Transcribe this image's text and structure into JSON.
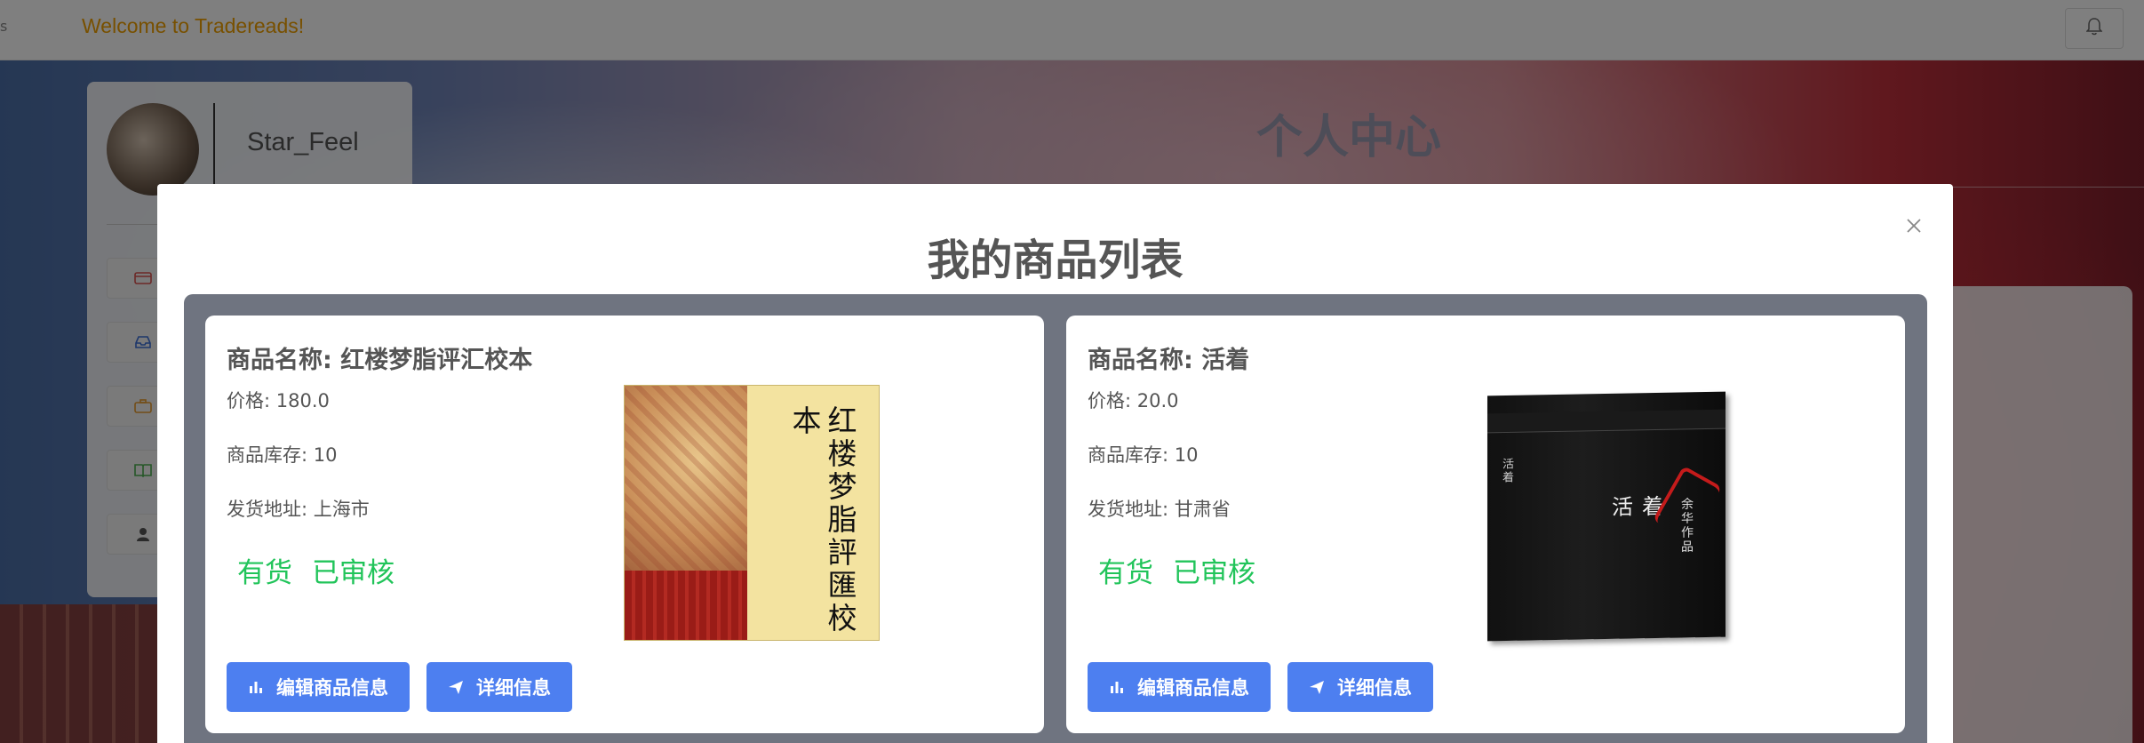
{
  "topbar": {
    "welcome": "Welcome to Tradereads!"
  },
  "profile": {
    "username": "Star_Feel"
  },
  "page": {
    "title": "个人中心"
  },
  "modal": {
    "title": "我的商品列表",
    "products": [
      {
        "name_prefix": "商品名称: ",
        "name": "红楼梦脂评汇校本",
        "price_label": "价格: 180.0",
        "stock_label": "商品库存: 10",
        "address_label": "发货地址: 上海市",
        "availability": "有货",
        "review_status": "已审核",
        "cover_text": "红楼梦脂評匯校本",
        "edit_label": "编辑商品信息",
        "detail_label": "详细信息"
      },
      {
        "name_prefix": "商品名称: ",
        "name": "活着",
        "price_label": "价格: 20.0",
        "stock_label": "商品库存: 10",
        "address_label": "发货地址: 甘肃省",
        "availability": "有货",
        "review_status": "已审核",
        "cover_text": "活着",
        "cover_subtext": "余华作品",
        "edit_label": "编辑商品信息",
        "detail_label": "详细信息"
      }
    ]
  },
  "colors": {
    "accent": "#4d7ff0",
    "status_green": "#21c45a",
    "welcome_orange": "#f0a000"
  },
  "icons": [
    "bell-icon",
    "close-icon",
    "bar-chart-icon",
    "send-icon"
  ]
}
